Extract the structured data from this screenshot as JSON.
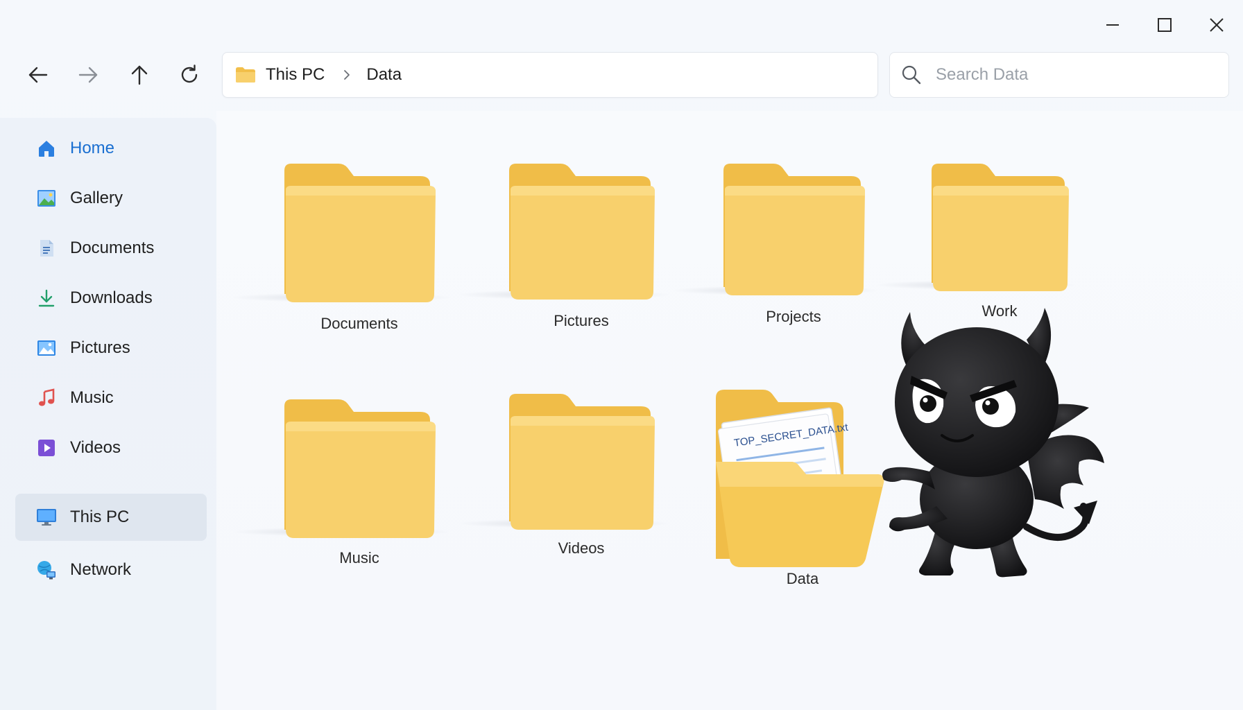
{
  "window": {
    "controls": {
      "minimize": "minimize-icon",
      "maximize": "maximize-icon",
      "close": "close-icon"
    }
  },
  "nav": {
    "back": "arrow-left-icon",
    "forward": "arrow-right-icon",
    "up": "arrow-up-icon",
    "refresh": "refresh-icon"
  },
  "address": {
    "crumbs": [
      "This PC",
      "Data"
    ]
  },
  "search": {
    "placeholder": "Search Data"
  },
  "sidebar": {
    "items": [
      {
        "label": "Home",
        "icon": "home-icon"
      },
      {
        "label": "Gallery",
        "icon": "gallery-icon"
      },
      {
        "label": "Documents",
        "icon": "document-icon"
      },
      {
        "label": "Downloads",
        "icon": "download-icon"
      },
      {
        "label": "Pictures",
        "icon": "pictures-icon"
      },
      {
        "label": "Music",
        "icon": "music-icon"
      },
      {
        "label": "Videos",
        "icon": "video-icon"
      },
      {
        "label": "This PC",
        "icon": "monitor-icon"
      },
      {
        "label": "Network",
        "icon": "network-icon"
      }
    ]
  },
  "folders": [
    {
      "label": "Documents"
    },
    {
      "label": "Pictures"
    },
    {
      "label": "Projects"
    },
    {
      "label": "Work"
    },
    {
      "label": "Music"
    },
    {
      "label": "Videos"
    },
    {
      "label": "Data",
      "document": "TOP_SECRET_DATA.txt"
    }
  ],
  "colors": {
    "accent": "#1a6fd1",
    "folder_front": "#f7cf6a",
    "folder_back": "#f2bf4a",
    "devil": "#1c1c1e"
  }
}
